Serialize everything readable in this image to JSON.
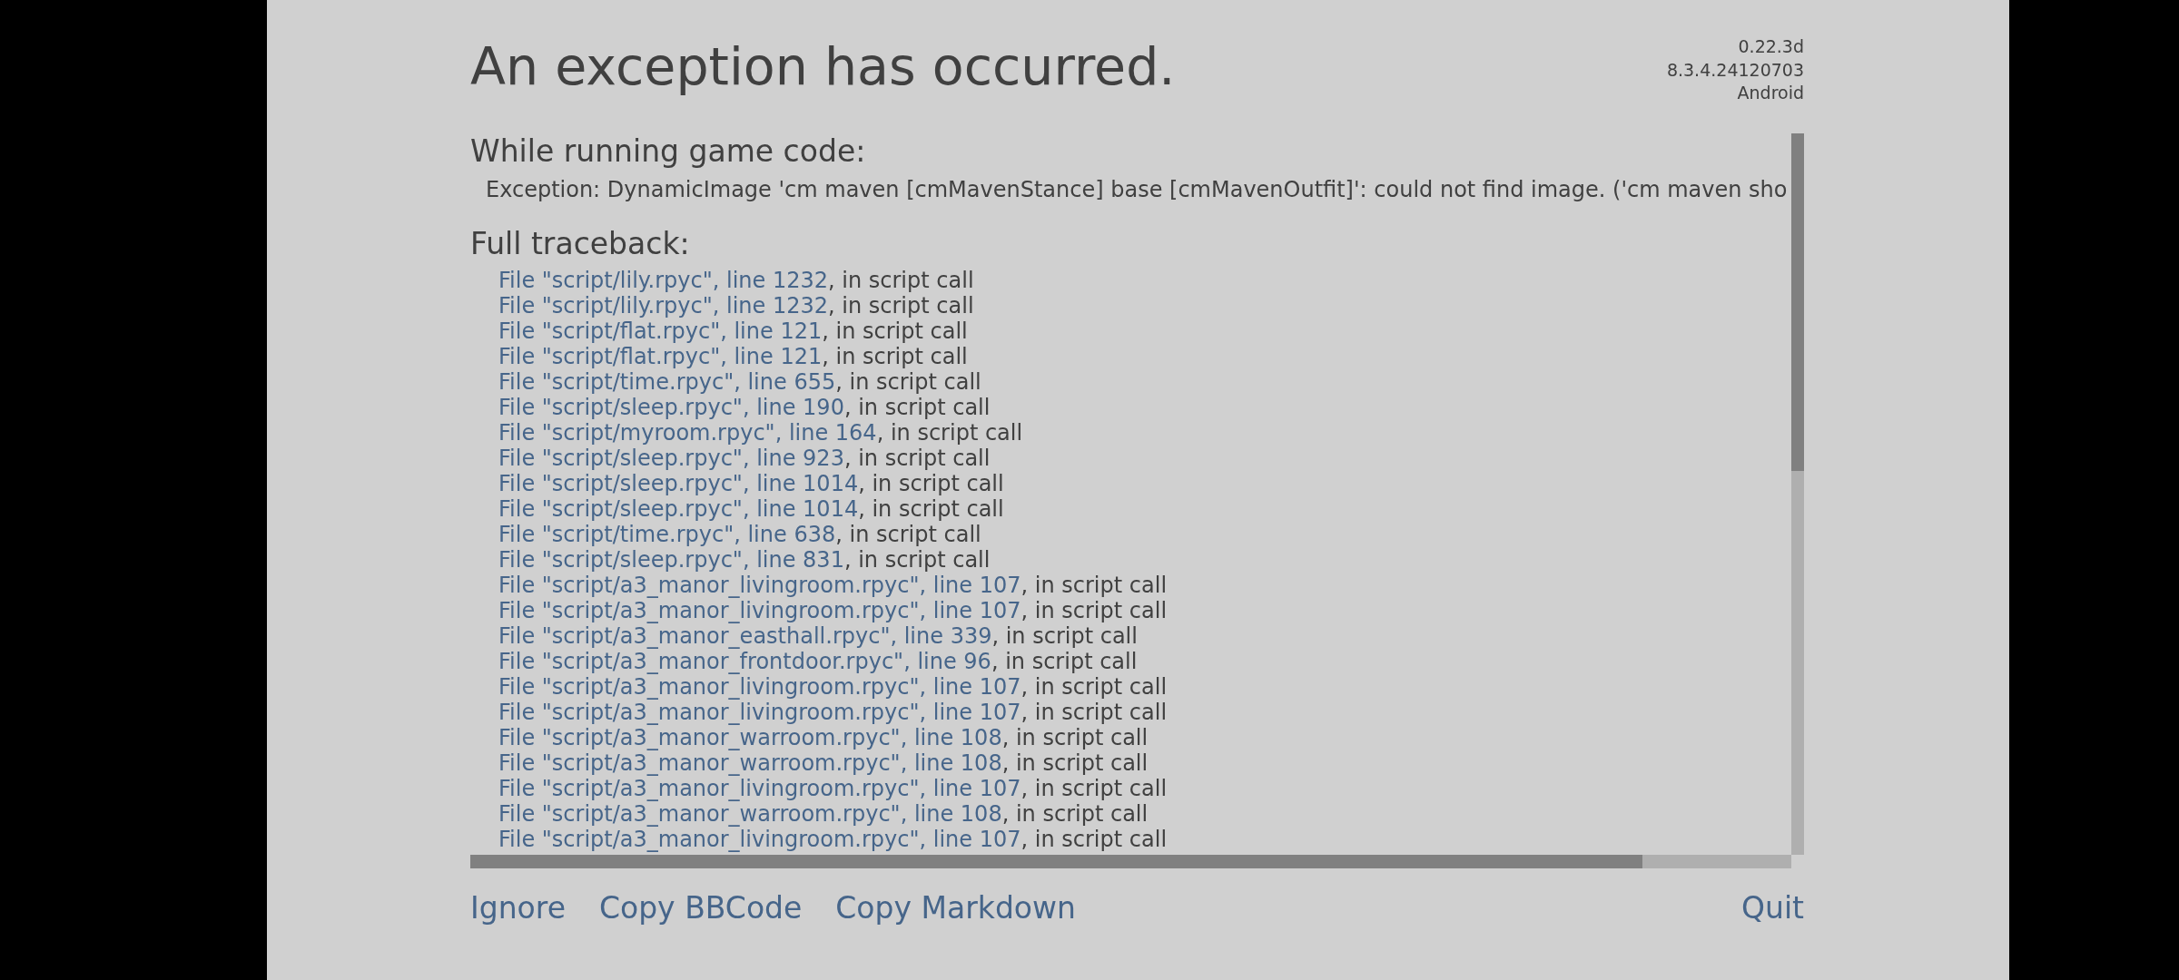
{
  "header": {
    "title": "An exception has occurred.",
    "version_lines": [
      "0.22.3d",
      "8.3.4.24120703",
      "Android"
    ]
  },
  "game_code": {
    "heading": "While running game code:",
    "exception": "Exception: DynamicImage 'cm maven [cmMavenStance] base [cmMavenOutfit]': could not find image. ('cm maven sho"
  },
  "traceback": {
    "heading": "Full traceback:",
    "lines": [
      {
        "link": "File \"script/lily.rpyc\", line 1232",
        "text": ", in script call"
      },
      {
        "link": "File \"script/lily.rpyc\", line 1232",
        "text": ", in script call"
      },
      {
        "link": "File \"script/flat.rpyc\", line 121",
        "text": ", in script call"
      },
      {
        "link": "File \"script/flat.rpyc\", line 121",
        "text": ", in script call"
      },
      {
        "link": "File \"script/time.rpyc\", line 655",
        "text": ", in script call"
      },
      {
        "link": "File \"script/sleep.rpyc\", line 190",
        "text": ", in script call"
      },
      {
        "link": "File \"script/myroom.rpyc\", line 164",
        "text": ", in script call"
      },
      {
        "link": "File \"script/sleep.rpyc\", line 923",
        "text": ", in script call"
      },
      {
        "link": "File \"script/sleep.rpyc\", line 1014",
        "text": ", in script call"
      },
      {
        "link": "File \"script/sleep.rpyc\", line 1014",
        "text": ", in script call"
      },
      {
        "link": "File \"script/time.rpyc\", line 638",
        "text": ", in script call"
      },
      {
        "link": "File \"script/sleep.rpyc\", line 831",
        "text": ", in script call"
      },
      {
        "link": "File \"script/a3_manor_livingroom.rpyc\", line 107",
        "text": ", in script call"
      },
      {
        "link": "File \"script/a3_manor_livingroom.rpyc\", line 107",
        "text": ", in script call"
      },
      {
        "link": "File \"script/a3_manor_easthall.rpyc\", line 339",
        "text": ", in script call"
      },
      {
        "link": "File \"script/a3_manor_frontdoor.rpyc\", line 96",
        "text": ", in script call"
      },
      {
        "link": "File \"script/a3_manor_livingroom.rpyc\", line 107",
        "text": ", in script call"
      },
      {
        "link": "File \"script/a3_manor_livingroom.rpyc\", line 107",
        "text": ", in script call"
      },
      {
        "link": "File \"script/a3_manor_warroom.rpyc\", line 108",
        "text": ", in script call"
      },
      {
        "link": "File \"script/a3_manor_warroom.rpyc\", line 108",
        "text": ", in script call"
      },
      {
        "link": "File \"script/a3_manor_livingroom.rpyc\", line 107",
        "text": ", in script call"
      },
      {
        "link": "File \"script/a3_manor_warroom.rpyc\", line 108",
        "text": ", in script call"
      },
      {
        "link": "File \"script/a3_manor_livingroom.rpyc\", line 107",
        "text": ", in script call"
      }
    ]
  },
  "buttons": {
    "left": [
      "Ignore",
      "Copy BBCode",
      "Copy Markdown"
    ],
    "right": [
      "Quit"
    ]
  }
}
